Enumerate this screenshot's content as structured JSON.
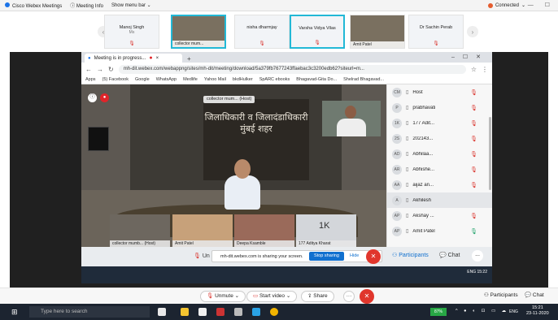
{
  "top_bar": {
    "app_title": "Cisco Webex Meetings",
    "meeting_info": "Meeting Info",
    "show_menu_bar": "Show menu bar",
    "status": "Connected",
    "window_controls": "— ☐"
  },
  "participant_strip": [
    {
      "name": "Manoj Singh",
      "sub": "Ms",
      "video": false,
      "active": false
    },
    {
      "name": "collector mum...",
      "sub": "",
      "video": true,
      "active": true
    },
    {
      "name": "nisha dharmjay",
      "sub": "",
      "video": false,
      "active": false
    },
    {
      "name": "Varsha Vidya Vilas",
      "sub": "",
      "video": false,
      "active": true
    },
    {
      "name": "Amit Patel",
      "sub": "",
      "video": true,
      "active": false
    },
    {
      "name": "Dr Sachin Perab",
      "sub": "",
      "video": false,
      "active": false
    }
  ],
  "browser": {
    "tab_title": "Meeting is in progress...",
    "url": "mh-dit.webex.com/webappng/sites/mh-dit/meeting/download/5a379fb7677243ffaebac3c3200edb62?siteurl=m...",
    "bookmarks": [
      "Apps",
      "(5) Facebook",
      "Google",
      "WhatsApp",
      "Medlife",
      "Yahoo Mail",
      "bkdHulker",
      "SpARC ebooks",
      "Bhagavad-Gita Do...",
      "Shelrad Bhagavad..."
    ]
  },
  "meeting": {
    "main_label": "collector mum... (Host)",
    "hindi_text": "जिलाधिकारी व जिलादंडाधिकारी मुंबई शहर",
    "thumbnails": [
      {
        "name": "collector mumb... (Host)"
      },
      {
        "name": "Amit Patel"
      },
      {
        "name": "Deepa Ksamble"
      },
      {
        "name": "177 Aditya Kharat",
        "big": "1K"
      }
    ],
    "participants": [
      {
        "initials": "CM",
        "name": "Host",
        "mic": "red"
      },
      {
        "initials": "P",
        "name": "prabhavati",
        "mic": "red"
      },
      {
        "initials": "1K",
        "name": "177 Adit...",
        "mic": "red"
      },
      {
        "initials": "2S",
        "name": "202143...",
        "mic": "red"
      },
      {
        "initials": "AD",
        "name": "Abhilaa...",
        "mic": "red"
      },
      {
        "initials": "AR",
        "name": "Abhishe...",
        "mic": "red"
      },
      {
        "initials": "AA",
        "name": "aijaz an...",
        "mic": "red"
      },
      {
        "initials": "A",
        "name": "Akhilesh",
        "mic": "none"
      },
      {
        "initials": "AP",
        "name": "Akshay ...",
        "mic": "red"
      },
      {
        "initials": "AP",
        "name": "Amit Patel",
        "mic": "green"
      }
    ],
    "share_bar": {
      "mute_label": "Un",
      "notice": "mh-dit.webex.com is sharing your screen.",
      "stop_sharing": "Stop sharing",
      "hide": "Hide",
      "participants": "Participants",
      "chat": "Chat",
      "more": "..."
    },
    "inner_clock": "ENG 15:22"
  },
  "controls": {
    "unmute": "Unmute",
    "start_video": "Start video",
    "share": "Share",
    "more": "···",
    "end": "✕",
    "participants": "Participants",
    "chat": "Chat"
  },
  "taskbar": {
    "search_placeholder": "Type here to search",
    "battery": "87%",
    "lang": "ENG",
    "time": "15:21",
    "date": "23-11-2020"
  },
  "colors": {
    "accent": "#1170cf",
    "end_call": "#e0362c",
    "active_tile": "#22b8d6",
    "mic_muted": "#d9352e"
  }
}
